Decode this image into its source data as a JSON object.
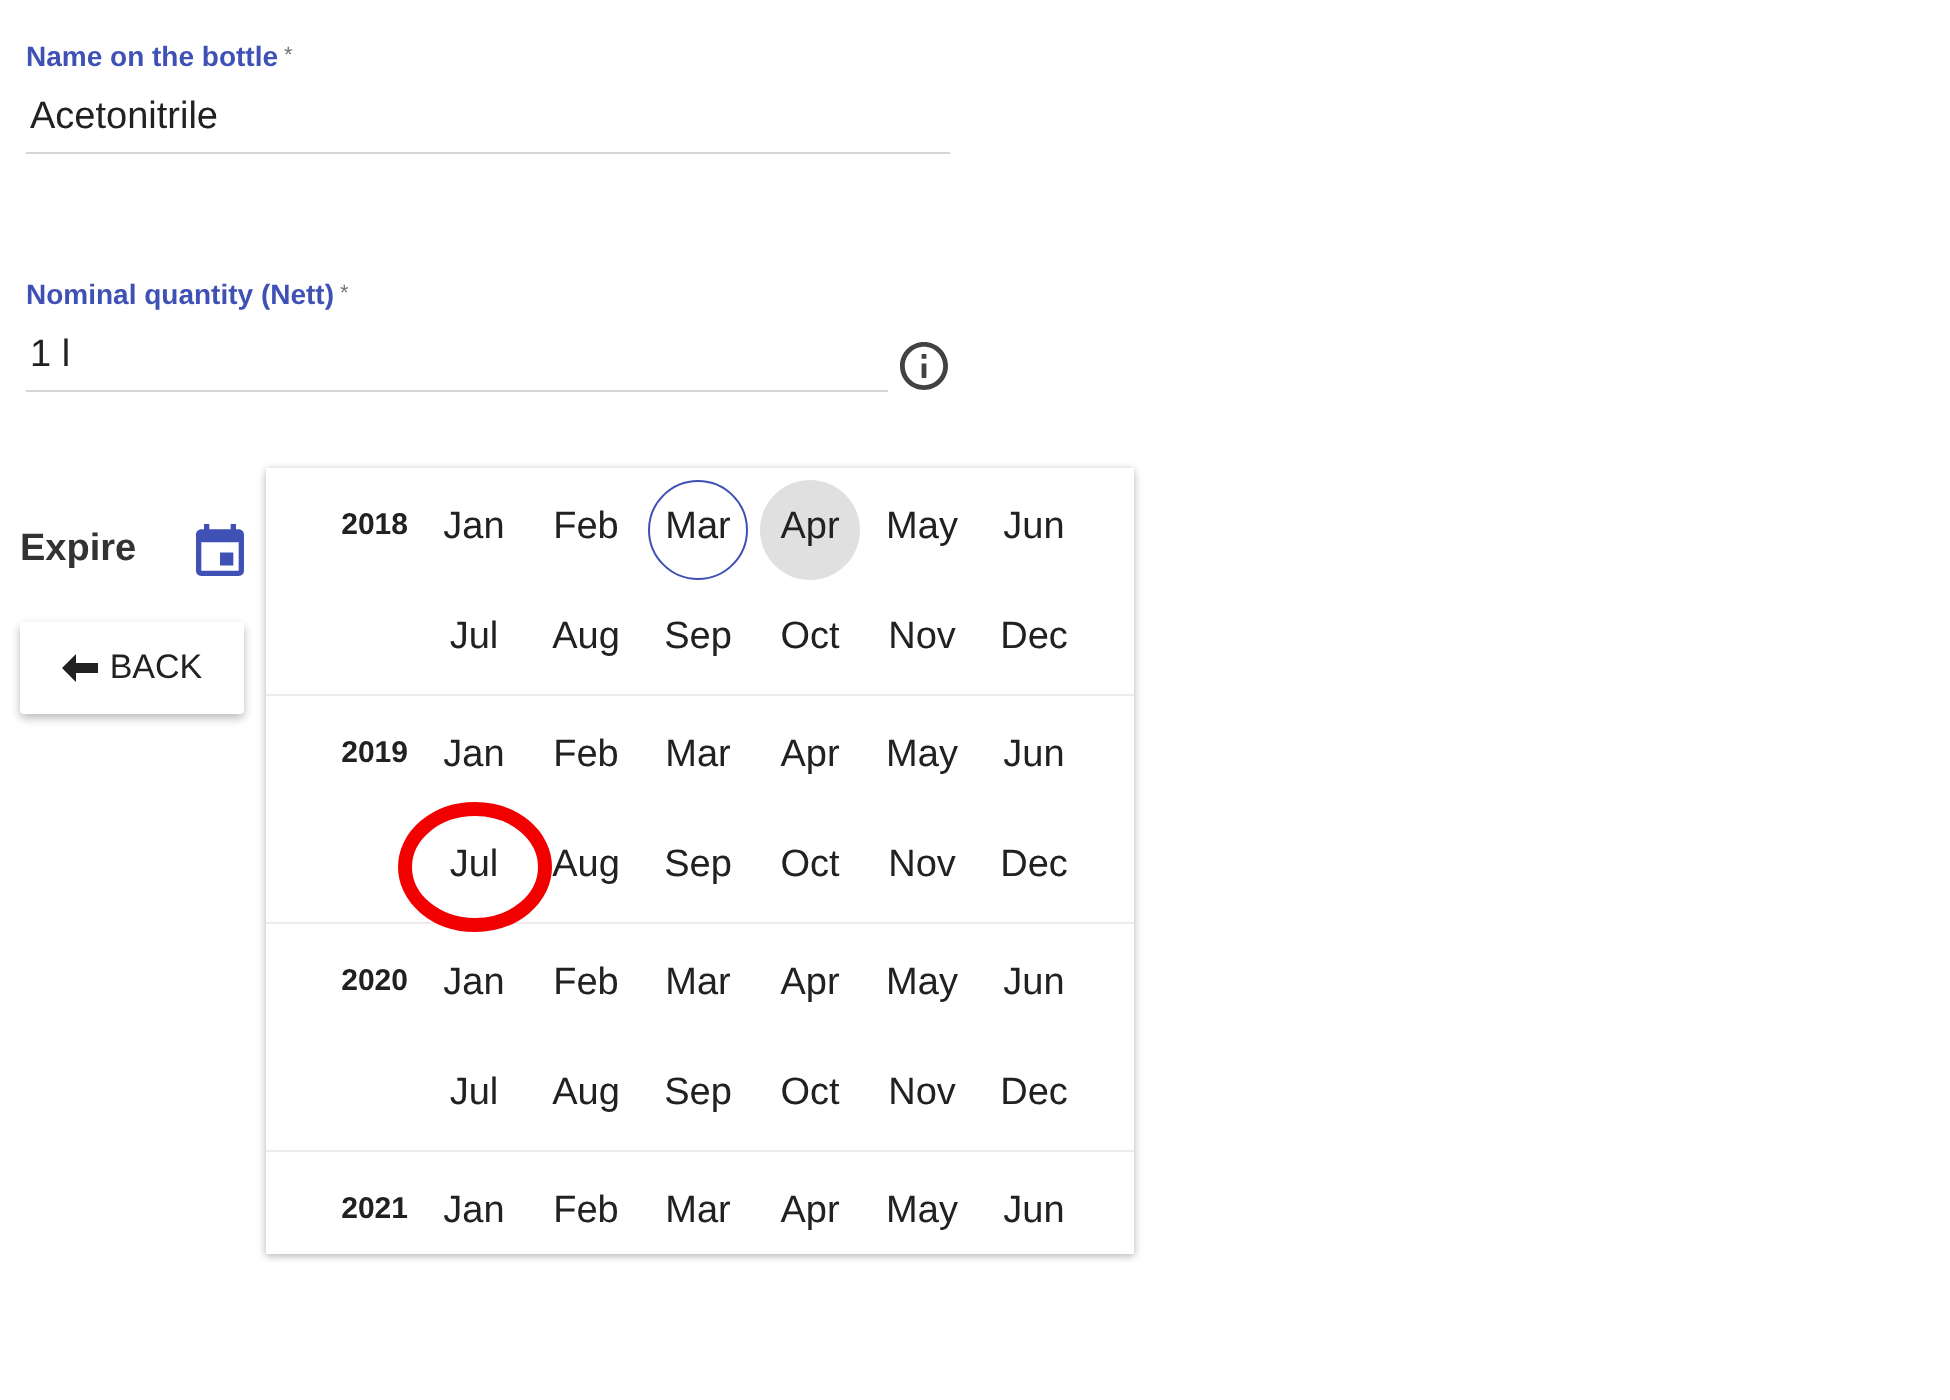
{
  "form": {
    "fields": [
      {
        "label": "Name on the bottle",
        "required_mark": "*",
        "value": "Acetonitrile",
        "info_icon": false
      },
      {
        "label": "Nominal quantity (Nett)",
        "required_mark": "*",
        "value": "1 l",
        "info_icon": true
      }
    ]
  },
  "expire": {
    "label": "Expire"
  },
  "back_button": {
    "label": "BACK"
  },
  "month_picker": {
    "years": [
      {
        "year": "2018",
        "months": [
          {
            "label": "Jan",
            "selected": false,
            "current": false,
            "circled": false
          },
          {
            "label": "Feb",
            "selected": false,
            "current": false,
            "circled": false
          },
          {
            "label": "Mar",
            "selected": false,
            "current": true,
            "circled": false
          },
          {
            "label": "Apr",
            "selected": true,
            "current": false,
            "circled": false
          },
          {
            "label": "May",
            "selected": false,
            "current": false,
            "circled": false
          },
          {
            "label": "Jun",
            "selected": false,
            "current": false,
            "circled": false
          },
          {
            "label": "Jul",
            "selected": false,
            "current": false,
            "circled": false
          },
          {
            "label": "Aug",
            "selected": false,
            "current": false,
            "circled": false
          },
          {
            "label": "Sep",
            "selected": false,
            "current": false,
            "circled": false
          },
          {
            "label": "Oct",
            "selected": false,
            "current": false,
            "circled": false
          },
          {
            "label": "Nov",
            "selected": false,
            "current": false,
            "circled": false
          },
          {
            "label": "Dec",
            "selected": false,
            "current": false,
            "circled": false
          }
        ]
      },
      {
        "year": "2019",
        "months": [
          {
            "label": "Jan",
            "selected": false,
            "current": false,
            "circled": false
          },
          {
            "label": "Feb",
            "selected": false,
            "current": false,
            "circled": false
          },
          {
            "label": "Mar",
            "selected": false,
            "current": false,
            "circled": false
          },
          {
            "label": "Apr",
            "selected": false,
            "current": false,
            "circled": false
          },
          {
            "label": "May",
            "selected": false,
            "current": false,
            "circled": false
          },
          {
            "label": "Jun",
            "selected": false,
            "current": false,
            "circled": false
          },
          {
            "label": "Jul",
            "selected": false,
            "current": false,
            "circled": true
          },
          {
            "label": "Aug",
            "selected": false,
            "current": false,
            "circled": false
          },
          {
            "label": "Sep",
            "selected": false,
            "current": false,
            "circled": false
          },
          {
            "label": "Oct",
            "selected": false,
            "current": false,
            "circled": false
          },
          {
            "label": "Nov",
            "selected": false,
            "current": false,
            "circled": false
          },
          {
            "label": "Dec",
            "selected": false,
            "current": false,
            "circled": false
          }
        ]
      },
      {
        "year": "2020",
        "months": [
          {
            "label": "Jan",
            "selected": false,
            "current": false,
            "circled": false
          },
          {
            "label": "Feb",
            "selected": false,
            "current": false,
            "circled": false
          },
          {
            "label": "Mar",
            "selected": false,
            "current": false,
            "circled": false
          },
          {
            "label": "Apr",
            "selected": false,
            "current": false,
            "circled": false
          },
          {
            "label": "May",
            "selected": false,
            "current": false,
            "circled": false
          },
          {
            "label": "Jun",
            "selected": false,
            "current": false,
            "circled": false
          },
          {
            "label": "Jul",
            "selected": false,
            "current": false,
            "circled": false
          },
          {
            "label": "Aug",
            "selected": false,
            "current": false,
            "circled": false
          },
          {
            "label": "Sep",
            "selected": false,
            "current": false,
            "circled": false
          },
          {
            "label": "Oct",
            "selected": false,
            "current": false,
            "circled": false
          },
          {
            "label": "Nov",
            "selected": false,
            "current": false,
            "circled": false
          },
          {
            "label": "Dec",
            "selected": false,
            "current": false,
            "circled": false
          }
        ]
      },
      {
        "year": "2021",
        "months": [
          {
            "label": "Jan",
            "selected": false,
            "current": false,
            "circled": false
          },
          {
            "label": "Feb",
            "selected": false,
            "current": false,
            "circled": false
          },
          {
            "label": "Mar",
            "selected": false,
            "current": false,
            "circled": false
          },
          {
            "label": "Apr",
            "selected": false,
            "current": false,
            "circled": false
          },
          {
            "label": "May",
            "selected": false,
            "current": false,
            "circled": false
          },
          {
            "label": "Jun",
            "selected": false,
            "current": false,
            "circled": false
          }
        ]
      }
    ]
  }
}
